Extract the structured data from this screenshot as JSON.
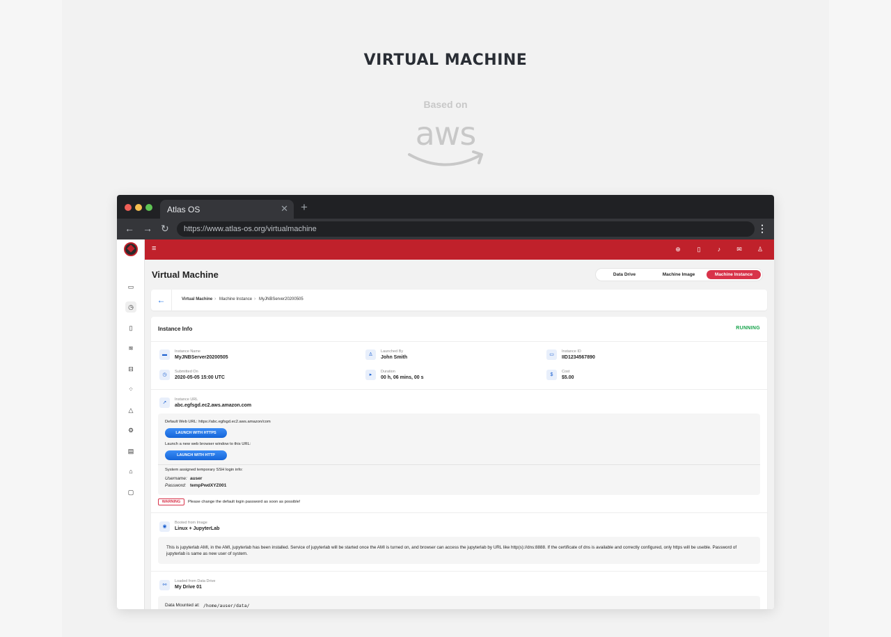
{
  "hero": {
    "title": "VIRTUAL MACHINE",
    "based_on": "Based on",
    "aws": "aws"
  },
  "browser": {
    "tab_title": "Atlas OS",
    "tab_close": "✕",
    "new_tab": "+",
    "url": "https://www.atlas-os.org/virtualmachine",
    "back": "←",
    "forward": "→",
    "reload": "↻",
    "menu": "⋮",
    "dots": {
      "red": "#ee5f57",
      "yellow": "#f4be4f",
      "green": "#5fc454"
    }
  },
  "colors": {
    "brand": "#c0212b",
    "accent": "#1a6fe8",
    "running": "#16a34a"
  },
  "sidebar": {
    "icons": [
      "inbox-icon",
      "clock-icon",
      "document-icon",
      "layers-icon",
      "drive-icon",
      "apps-icon",
      "warning-icon",
      "gear-icon",
      "storage-icon",
      "trash-icon",
      "chat-icon"
    ]
  },
  "topbar": {
    "menu_icon": "≡",
    "icons": [
      "download-icon",
      "tablet-icon",
      "bell-icon",
      "mail-icon",
      "user-icon"
    ]
  },
  "page": {
    "title": "Virtual Machine",
    "tabs": [
      {
        "label": "Data Drive",
        "active": false
      },
      {
        "label": "Machine Image",
        "active": false
      },
      {
        "label": "Machine Instance",
        "active": true
      }
    ],
    "breadcrumb": [
      "Virtual Machine",
      "Machine Instance",
      "MyJNBServer20200505"
    ]
  },
  "instance": {
    "header": "Instance Info",
    "status": "RUNNING",
    "fields": {
      "name": {
        "label": "Instance Name",
        "value": "MyJNBServer20200505"
      },
      "launched_by": {
        "label": "Launched By",
        "value": "John Smith"
      },
      "id": {
        "label": "Instance ID",
        "value": "IID1234567890"
      },
      "submitted": {
        "label": "Submitted On",
        "value": "2020-05-05 15:00 UTC"
      },
      "duration": {
        "label": "Duration",
        "value": "00 h, 06 mins, 00 s"
      },
      "cost": {
        "label": "Cost",
        "value": "$5.00"
      }
    },
    "url_section": {
      "label": "Instance URL",
      "value": "abc.egfsgd.ec2.aws.amazon.com",
      "default_web_url": "Default Web URL: https://abc.egfsgd.ec2.aws.amazon/com",
      "launch_https": "LAUNCH WITH HTTPS",
      "new_window_text": "Launch a new web browser window to this URL:",
      "launch_http": "LAUNCH WITH HTTP",
      "ssh_intro": "System assigned temporary SSH login info:",
      "username_label": "Username:",
      "username_value": "auser",
      "password_label": "Password:",
      "password_value": "tempPwdXYZ001",
      "warning_badge": "WARNING",
      "warning_text": "Please change the default login password as soon as possible!"
    },
    "image_section": {
      "label": "Booted from Image",
      "value": "Linux + JupyterLab",
      "description": "This is jupyterlab AMI, in the AMI, jupyterlab has been installed. Service of jupyterlab will be started once the AMI is turned on, and browser can access the jupyterlab by URL like http(s)://dns:8888. If the certificate of dns is available and correctly configured, only https will be useble. Password of jupyterlab is same as new user of system."
    },
    "drive_section": {
      "label": "Loaded from Data Drive",
      "value": "My Drive 01",
      "mounted_label": "Data Mounted at:",
      "mounted_path": "/home/auser/data/"
    }
  }
}
